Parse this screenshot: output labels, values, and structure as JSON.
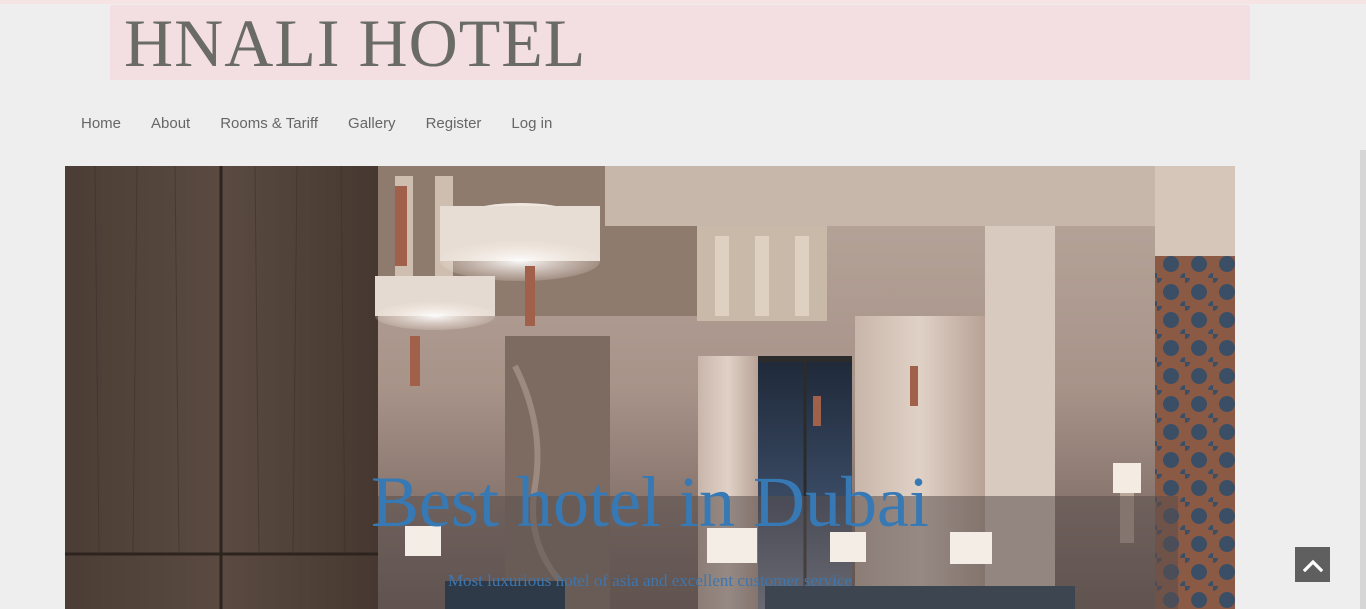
{
  "brand": {
    "title": "HNALI HOTEL"
  },
  "nav": {
    "items": [
      {
        "label": "Home"
      },
      {
        "label": "About"
      },
      {
        "label": "Rooms & Tariff"
      },
      {
        "label": "Gallery"
      },
      {
        "label": "Register"
      },
      {
        "label": "Log in"
      }
    ]
  },
  "hero": {
    "title": "Best hotel in Dubai",
    "subtitle": "Most luxurious hotel of asia and excellent customer service"
  },
  "controls": {
    "back_to_top_icon": "chevron-up-icon"
  },
  "colors": {
    "page_bg": "#eeeeee",
    "brand_bg": "#f3dee1",
    "brand_text": "#6b6b66",
    "nav_text": "#666666",
    "hero_title": "#3679b5",
    "back_to_top_bg": "#5f5f5f"
  }
}
